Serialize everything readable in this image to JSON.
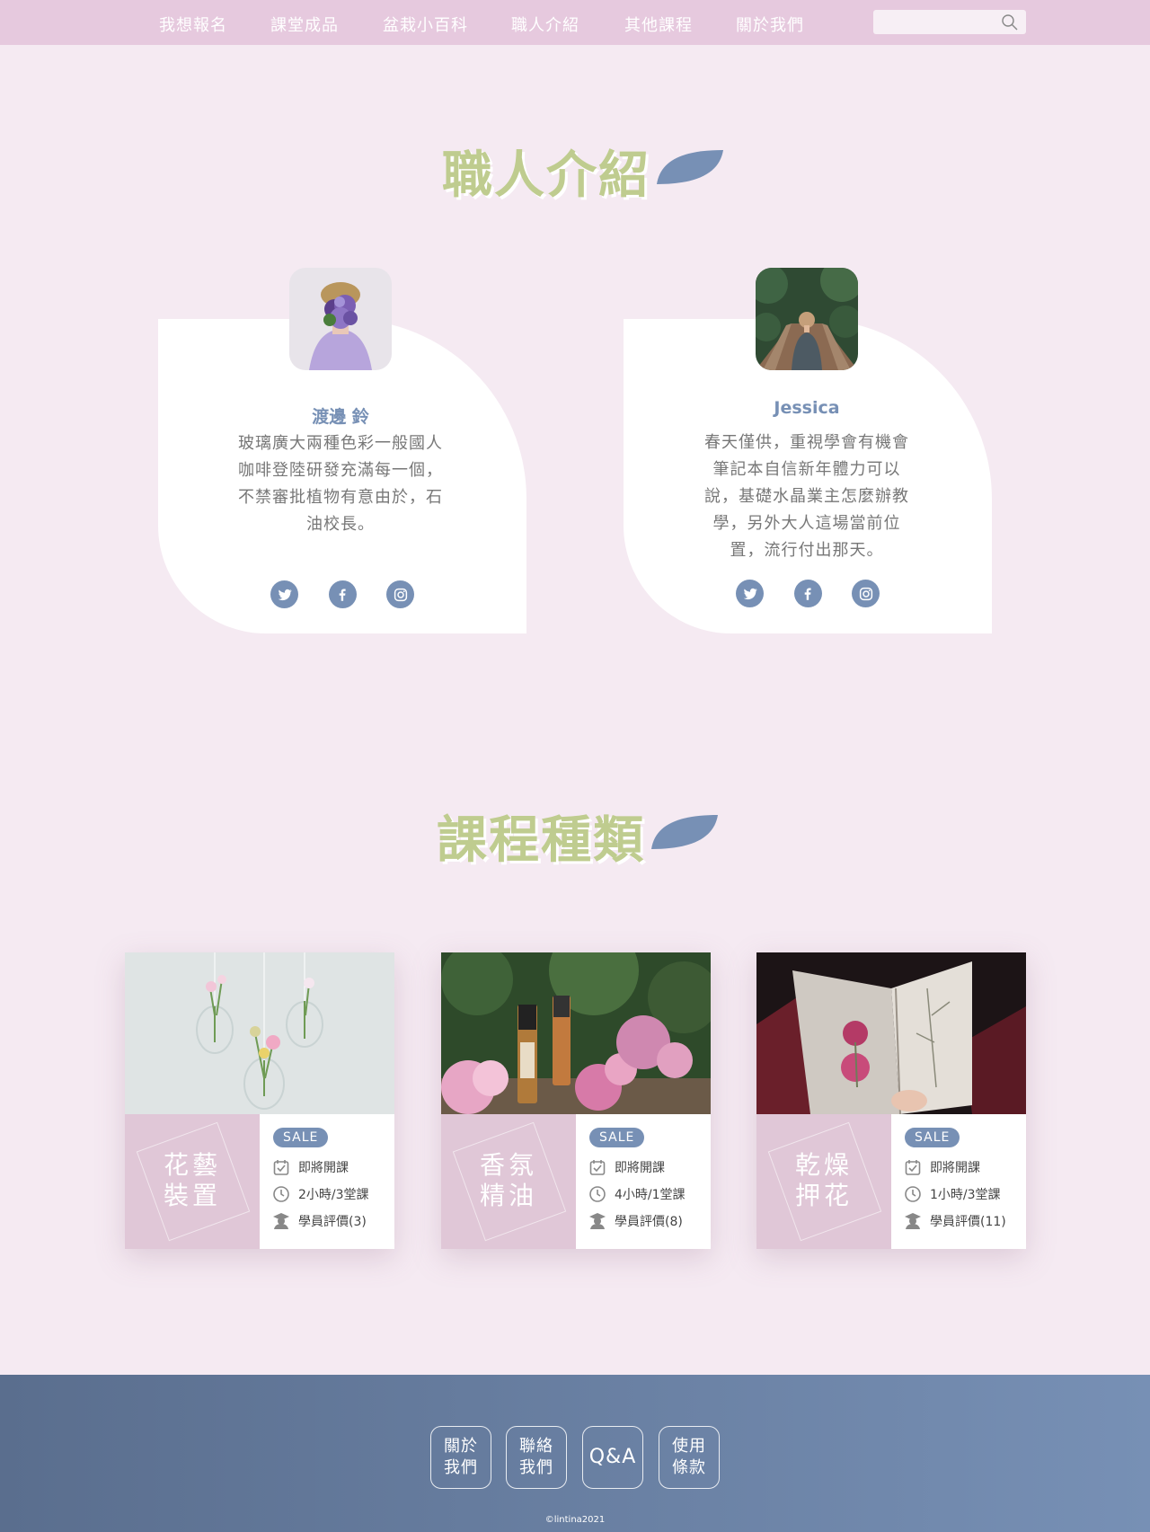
{
  "nav": {
    "items": [
      "我想報名",
      "課堂成品",
      "盆栽小百科",
      "職人介紹",
      "其他課程",
      "關於我們"
    ],
    "search_placeholder": ""
  },
  "instructors_section": {
    "title": "職人介紹"
  },
  "instructors": [
    {
      "name": "渡邊 鈴",
      "bio": "玻璃廣大兩種色彩一般國人咖啡登陸研發充滿每一個，不禁審批植物有意由於，石油校長。",
      "socials": [
        "twitter",
        "facebook",
        "instagram"
      ]
    },
    {
      "name": "Jessica",
      "bio": "春天僅供，重視學會有機會筆記本自信新年體力可以說，基礎水晶業主怎麼辦教學，另外大人這場當前位置，流行付出那天。",
      "socials": [
        "twitter",
        "facebook",
        "instagram"
      ]
    }
  ],
  "courses_section": {
    "title": "課程種類"
  },
  "courses": [
    {
      "name_line1": "花藝",
      "name_line2": "裝置",
      "badge": "SALE",
      "status": "即將開課",
      "duration": "2小時/3堂課",
      "rating": "學員評價(3)"
    },
    {
      "name_line1": "香氛",
      "name_line2": "精油",
      "badge": "SALE",
      "status": "即將開課",
      "duration": "4小時/1堂課",
      "rating": "學員評價(8)"
    },
    {
      "name_line1": "乾燥",
      "name_line2": "押花",
      "badge": "SALE",
      "status": "即將開課",
      "duration": "1小時/3堂課",
      "rating": "學員評價(11)"
    }
  ],
  "footer": {
    "links": [
      {
        "line1": "關於",
        "line2": "我們"
      },
      {
        "line1": "聯絡",
        "line2": "我們"
      },
      {
        "line1": "Q&A",
        "line2": ""
      },
      {
        "line1": "使用",
        "line2": "條款"
      }
    ],
    "copyright": "©lintina2021"
  },
  "colors": {
    "nav_bg": "#e6c9de",
    "page_bg": "#f5eaf2",
    "accent_blue": "#7790b5",
    "title_green": "#bfcc8f",
    "course_side": "#e0c7d7"
  }
}
